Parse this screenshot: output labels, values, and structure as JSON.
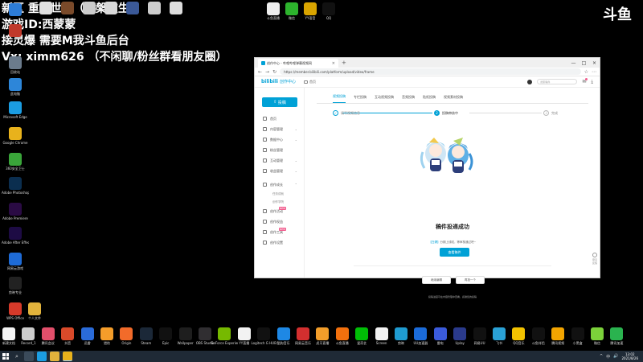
{
  "overlay": {
    "line1": "新区 重逢世界（涅槃重生）",
    "line2": "游戏ID:西蒙蒙",
    "line3": "接灵爆 需要M我斗鱼后台",
    "line4": "Vx: ximm626 （不闲聊/粉丝群看朋友圈）",
    "brand": "斗鱼"
  },
  "desktop": {
    "left_column": [
      {
        "label": "",
        "color": "#2d7cd6"
      },
      {
        "label": "",
        "color": "#c0392b"
      },
      {
        "label": "回收站",
        "color": "#6b7b8c"
      },
      {
        "label": "此电脑",
        "color": "#2d86d9"
      },
      {
        "label": "Microsoft Edge",
        "color": "#1b9de2"
      },
      {
        "label": "Google Chrome",
        "color": "#e8b21c"
      },
      {
        "label": "360安全卫士",
        "color": "#3aa53a"
      },
      {
        "label": "Adobe Photoshop",
        "color": "#0b2e4f"
      },
      {
        "label": "Adobe Premiere",
        "color": "#2a0b44"
      },
      {
        "label": "Adobe After Effects 2020",
        "color": "#1d0b44"
      },
      {
        "label": "网易云游戏",
        "color": "#1e6bd6"
      },
      {
        "label": "剪映专业",
        "color": "#222222"
      },
      {
        "label": "WPS Office",
        "color": "#d63a2a"
      },
      {
        "label": "个人文件",
        "color": "#e2b33c"
      }
    ],
    "top_row": [
      {
        "label": "",
        "color": "#e0e0e0"
      },
      {
        "label": "",
        "color": "#7a4a2a"
      },
      {
        "label": "",
        "color": "#cccccc"
      },
      {
        "label": "",
        "color": "#d9d9d9"
      },
      {
        "label": "",
        "color": "#3b5998"
      },
      {
        "label": "",
        "color": "#cccccc"
      },
      {
        "label": "",
        "color": "#dddddd"
      }
    ],
    "top_row_mid": [
      {
        "label": "斗鱼直播",
        "color": "#eeeeee"
      },
      {
        "label": "微信",
        "color": "#2db32d"
      },
      {
        "label": "YY语音",
        "color": "#d9a400"
      },
      {
        "label": "QQ",
        "color": "#111111"
      }
    ],
    "bottom_row": [
      {
        "label": "新建文档",
        "color": "#f2f2f2"
      },
      {
        "label": "Record_1",
        "color": "#cccccc"
      },
      {
        "label": "腾讯会议",
        "color": "#e24f6b"
      },
      {
        "label": "抖音",
        "color": "#d94a2a"
      },
      {
        "label": "迅雷",
        "color": "#2a6bd9"
      },
      {
        "label": "猎豹",
        "color": "#f59d2a"
      },
      {
        "label": "Origin",
        "color": "#f26b2a"
      },
      {
        "label": "Steam",
        "color": "#1b2838"
      },
      {
        "label": "Epic",
        "color": "#111111"
      },
      {
        "label": "Wallpaper",
        "color": "#1e1e1e"
      },
      {
        "label": "OBS Studio",
        "color": "#302e31"
      },
      {
        "label": "GeForce Experience",
        "color": "#76b900"
      },
      {
        "label": "YY直播",
        "color": "#f2f2f2"
      },
      {
        "label": "Logitech G HUB",
        "color": "#111111"
      },
      {
        "label": "酷狗音乐",
        "color": "#1e88e5"
      },
      {
        "label": "网易云音乐",
        "color": "#d32f2f"
      },
      {
        "label": "虎牙直播",
        "color": "#f29d2a"
      },
      {
        "label": "斗鱼直播",
        "color": "#f2700d"
      },
      {
        "label": "爱奇艺",
        "color": "#00be06"
      },
      {
        "label": "Screen",
        "color": "#f2f2f2"
      },
      {
        "label": "剪映",
        "color": "#1f9bd1"
      },
      {
        "label": "UU加速器",
        "color": "#1b6bd9"
      },
      {
        "label": "雷电",
        "color": "#3b5bdb"
      },
      {
        "label": "Uplay",
        "color": "#2a3a8c"
      },
      {
        "label": "网易UU",
        "color": "#111111"
      },
      {
        "label": "飞书",
        "color": "#2aa1d6"
      },
      {
        "label": "QQ音乐",
        "color": "#f2c200"
      },
      {
        "label": "斗鱼伴侣",
        "color": "#111111"
      },
      {
        "label": "腾讯视频",
        "color": "#f2a400"
      },
      {
        "label": "小黑盒",
        "color": "#111111"
      },
      {
        "label": "微信",
        "color": "#7bd13a"
      },
      {
        "label": "腾讯加速",
        "color": "#2ab34f"
      }
    ]
  },
  "browser": {
    "tab_title": "创作中心 - 哔哩哔哩弹幕视频网",
    "tab_close": "×",
    "new_tab": "+",
    "win_min": "—",
    "win_max": "□",
    "win_close": "×",
    "nav_back": "←",
    "nav_forward": "→",
    "nav_reload": "↻",
    "url": "https://member.bilibili.com/platform/upload/video/frame",
    "tool1": "☆",
    "tool2": "⋯"
  },
  "app": {
    "logo": "bilibili",
    "subtitle": "创作中心",
    "home_label": "首页",
    "search_placeholder": "搜索稿件",
    "upload_button": "投稿",
    "sidebar": [
      {
        "label": "首页",
        "arrow": ""
      },
      {
        "label": "内容管理",
        "arrow": "⌄"
      },
      {
        "label": "数据中心",
        "arrow": "⌄"
      },
      {
        "label": "粉丝管理",
        "arrow": ""
      },
      {
        "label": "互动管理",
        "arrow": "⌄"
      },
      {
        "label": "收益管理",
        "arrow": "⌄"
      }
    ],
    "sidebar_group": {
      "label": "创作成长",
      "arrow": "⌃"
    },
    "sidebar_sub": [
      "任务成就",
      "创作学院"
    ],
    "sidebar_more": [
      {
        "label": "创作活动",
        "badge": "NEW"
      },
      {
        "label": "创作权益"
      },
      {
        "label": "创作工具",
        "badge": "NEW"
      },
      {
        "label": "创作设置"
      }
    ],
    "tabs": [
      "视频投稿",
      "专栏投稿",
      "互动视频投稿",
      "音频投稿",
      "贴纸投稿",
      "视频素材投稿"
    ],
    "steps": [
      {
        "label": "填写视频信息",
        "num": "✓",
        "state": "done"
      },
      {
        "label": "投稿审核中",
        "num": "2",
        "state": "current"
      },
      {
        "label": "完成",
        "num": "3",
        "state": "todo"
      }
    ],
    "success_title": "稿件投递成功",
    "success_msg_prefix": "【白嫖】",
    "success_msg_text": "分期上线啦，等审核通过吧~",
    "view_button": "查看稿件",
    "edit_button": "继续编辑",
    "again_button": "再投一个",
    "bottom_hint": "投稿进度可在内容管理中查看，感谢您的投稿",
    "feedback": "意见反馈"
  },
  "taskbar": {
    "search_icon": "⌕",
    "tray_items": [
      "^",
      "中",
      "🔊"
    ],
    "time": "13:02",
    "date": "2021/8/26"
  }
}
